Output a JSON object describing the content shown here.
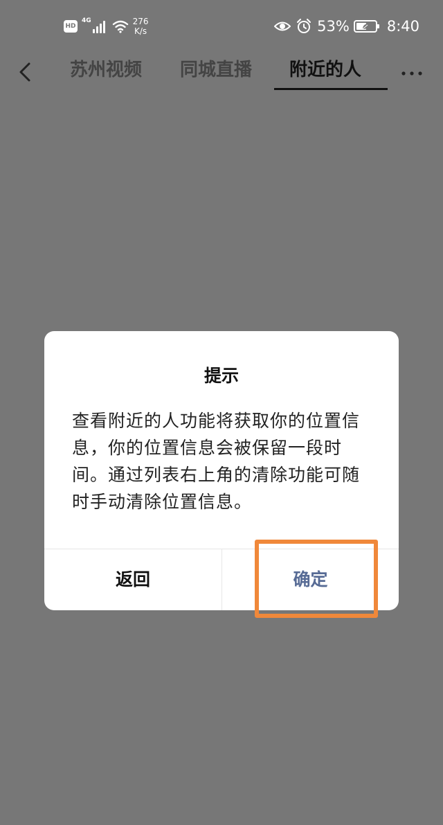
{
  "status_bar": {
    "hd_label": "HD",
    "network_type": "4G",
    "net_speed_value": "276",
    "net_speed_unit": "K/s",
    "battery_percent": "53%",
    "time": "8:40",
    "battery_level": 0.53,
    "icons": [
      "signal-icon",
      "wifi-icon",
      "eye-icon",
      "alarm-icon",
      "battery-icon",
      "leaf-icon"
    ]
  },
  "nav": {
    "tabs": [
      {
        "label": "苏州视频",
        "active": false
      },
      {
        "label": "同城直播",
        "active": false
      },
      {
        "label": "附近的人",
        "active": true
      }
    ],
    "back_icon": "chevron-left-icon",
    "more_icon": "more-horizontal-icon"
  },
  "dialog": {
    "title": "提示",
    "message": "查看附近的人功能将获取你的位置信息，你的位置信息会被保留一段时间。通过列表右上角的清除功能可随时手动清除位置信息。",
    "cancel_label": "返回",
    "confirm_label": "确定"
  },
  "colors": {
    "overlay": "#777777",
    "dialog_bg": "#ffffff",
    "confirm_text": "#576b95",
    "highlight": "#f0883a"
  }
}
